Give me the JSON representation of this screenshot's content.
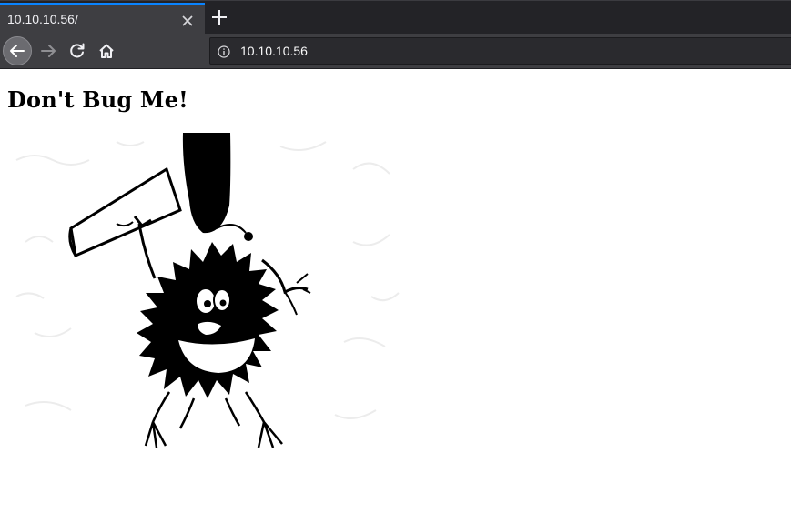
{
  "browser": {
    "tab": {
      "title": "10.10.10.56/"
    },
    "url": "10.10.10.56",
    "icons": [
      "close-icon",
      "plus-icon",
      "back-arrow-icon",
      "forward-arrow-icon",
      "reload-icon",
      "home-icon",
      "info-icon"
    ]
  },
  "page": {
    "heading": "Don't Bug Me!",
    "image": {
      "description_icon": "bug-cartoon-image"
    }
  },
  "colors": {
    "accent": "#0a84ff",
    "chrome_dark": "#232327",
    "chrome": "#3e3e42"
  }
}
